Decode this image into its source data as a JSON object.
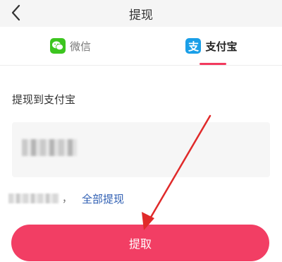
{
  "navbar": {
    "title": "提现",
    "back_icon": "chevron-left-icon"
  },
  "tabs": [
    {
      "label": "微信",
      "icon": "wechat-icon",
      "active": false
    },
    {
      "label": "支付宝",
      "icon": "alipay-icon",
      "icon_glyph": "支",
      "active": true
    }
  ],
  "form": {
    "section_label": "提现到支付宝",
    "balance_separator": "，",
    "withdraw_all_label": "全部提现",
    "submit_label": "提取"
  },
  "colors": {
    "accent": "#f23e64",
    "link": "#2f5fb3",
    "wechat_green": "#3cc51f",
    "alipay_blue": "#1a9fe8",
    "annotation_arrow": "#e02a2a"
  }
}
